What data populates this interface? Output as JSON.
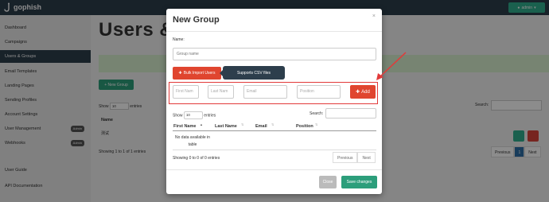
{
  "app": {
    "brand": "gophish",
    "user_label": "admin",
    "page_title": "Users & Groups"
  },
  "sidebar": {
    "items": [
      {
        "label": "Dashboard"
      },
      {
        "label": "Campaigns"
      },
      {
        "label": "Users & Groups"
      },
      {
        "label": "Email Templates"
      },
      {
        "label": "Landing Pages"
      },
      {
        "label": "Sending Profiles"
      },
      {
        "label": "Account Settings"
      },
      {
        "label": "User Management",
        "badge": "Admin"
      },
      {
        "label": "Webhooks",
        "badge": "Admin"
      },
      {
        "label": "User Guide"
      },
      {
        "label": "API Documentation"
      }
    ]
  },
  "background": {
    "new_group_label": "+ New Group",
    "show_label": "Show",
    "show_value": "10",
    "entries_label": "entries",
    "search_label": "Search:",
    "name_header": "Name",
    "row_name": "测试",
    "showing_text": "Showing 1 to 1 of 1 entries",
    "pager": [
      "Previous",
      "1",
      "Next"
    ]
  },
  "modal": {
    "title": "New Group",
    "close_glyph": "×",
    "name_label": "Name:",
    "name_placeholder": "Group name",
    "bulk_import_label": "Bulk Import Users",
    "csv_tooltip": "Supports CSV files",
    "first_name_placeholder": "First Nam",
    "last_name_placeholder": "Last Nam",
    "email_placeholder": "Email",
    "position_placeholder": "Position",
    "add_label": "Add",
    "show_label": "Show",
    "show_value": "10",
    "entries_label": "entries",
    "search_label": "Search:",
    "columns": [
      "First Name",
      "Last Name",
      "Email",
      "Position"
    ],
    "no_data": "No data available in table",
    "showing_text": "Showing 0 to 0 of 0 entries",
    "pager": [
      "Previous",
      "Next"
    ],
    "close_button": "Close",
    "save_button": "Save changes"
  },
  "colors": {
    "accent_red": "#e0452f",
    "accent_green": "#2c9e7b",
    "nav_dark": "#2d3e4c",
    "highlight": "#e23a3a"
  }
}
